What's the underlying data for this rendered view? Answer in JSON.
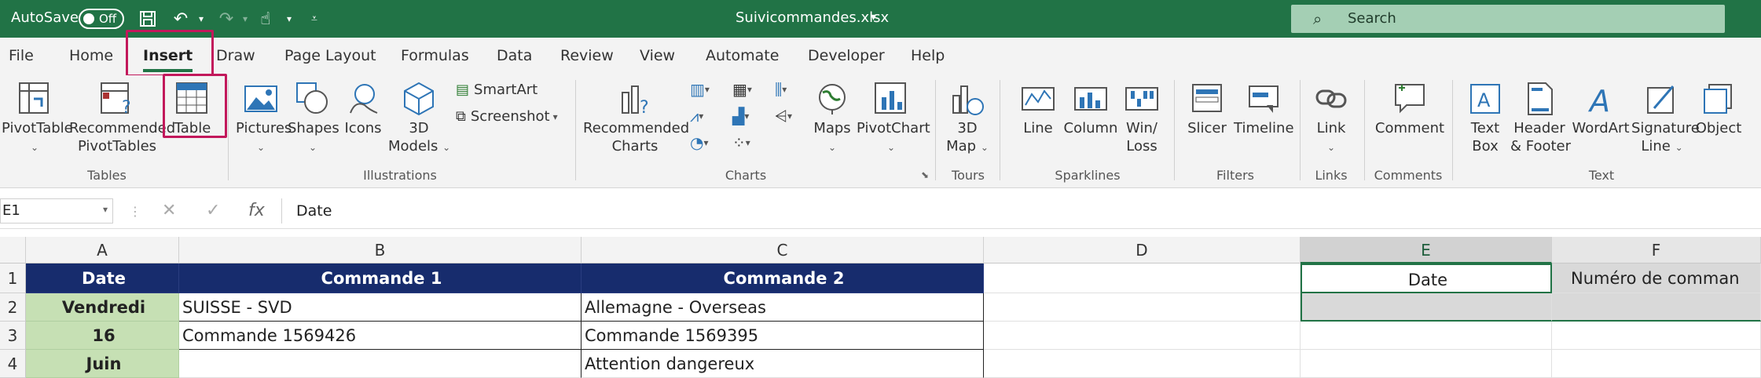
{
  "titlebar": {
    "autosave_label": "AutoSave",
    "autosave_state": "Off",
    "filename": "Suivicommandes.xlsx",
    "search_placeholder": "Search"
  },
  "tabs": [
    "File",
    "Home",
    "Insert",
    "Draw",
    "Page Layout",
    "Formulas",
    "Data",
    "Review",
    "View",
    "Automate",
    "Developer",
    "Help"
  ],
  "active_tab": "Insert",
  "ribbon": {
    "pivottable": "PivotTable",
    "rec_pivot_1": "Recommended",
    "rec_pivot_2": "PivotTables",
    "table": "Table",
    "group_tables": "Tables",
    "pictures": "Pictures",
    "shapes": "Shapes",
    "icons": "Icons",
    "models_1": "3D",
    "models_2": "Models",
    "smartart": "SmartArt",
    "screenshot": "Screenshot",
    "group_illustrations": "Illustrations",
    "rec_charts_1": "Recommended",
    "rec_charts_2": "Charts",
    "maps": "Maps",
    "pivotchart": "PivotChart",
    "group_charts": "Charts",
    "map3d_1": "3D",
    "map3d_2": "Map",
    "group_tours": "Tours",
    "line": "Line",
    "column": "Column",
    "winloss_1": "Win/",
    "winloss_2": "Loss",
    "group_sparklines": "Sparklines",
    "slicer": "Slicer",
    "timeline": "Timeline",
    "group_filters": "Filters",
    "link": "Link",
    "group_links": "Links",
    "comment": "Comment",
    "group_comments": "Comments",
    "textbox_1": "Text",
    "textbox_2": "Box",
    "header_1": "Header",
    "header_2": "& Footer",
    "wordart": "WordArt",
    "signature_1": "Signature",
    "signature_2": "Line",
    "object": "Object",
    "group_text": "Text"
  },
  "formula_bar": {
    "cell_ref": "E1",
    "fx": "fx",
    "value": "Date"
  },
  "grid": {
    "columns": [
      "A",
      "B",
      "C",
      "D",
      "E",
      "F"
    ],
    "rows": [
      "1",
      "2",
      "3",
      "4"
    ],
    "A1": "Date",
    "B1": "Commande 1",
    "C1": "Commande 2",
    "E1": "Date",
    "F1": "Numéro de comman",
    "A2": "Vendredi",
    "B2": "SUISSE - SVD",
    "C2": "Allemagne - Overseas",
    "A3": "16",
    "B3": "Commande 1569426",
    "C3": "Commande 1569395",
    "A4": "Juin",
    "C4": "Attention dangereux"
  },
  "colors": {
    "excel_green": "#217346",
    "header_navy": "#172c6d",
    "date_green": "#c6e0b4",
    "highlight": "#c2185b"
  }
}
